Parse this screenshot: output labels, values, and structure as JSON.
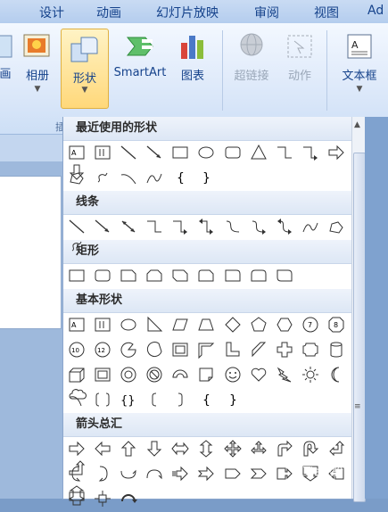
{
  "tabs": [
    "设计",
    "动画",
    "幻灯片放映",
    "审阅",
    "视图",
    "Ad"
  ],
  "ribbon": {
    "picture_cut": "画",
    "album": "相册",
    "shapes": "形状",
    "smartart": "SmartArt",
    "chart": "图表",
    "hyperlink": "超链接",
    "action": "动作",
    "textbox": "文本框",
    "group_cut": "插"
  },
  "gallery": {
    "sections": [
      {
        "title": "最近使用的形状"
      },
      {
        "title": "线条"
      },
      {
        "title": "矩形"
      },
      {
        "title": "基本形状"
      },
      {
        "title": "箭头总汇"
      }
    ]
  },
  "watermark": "Tie经验"
}
